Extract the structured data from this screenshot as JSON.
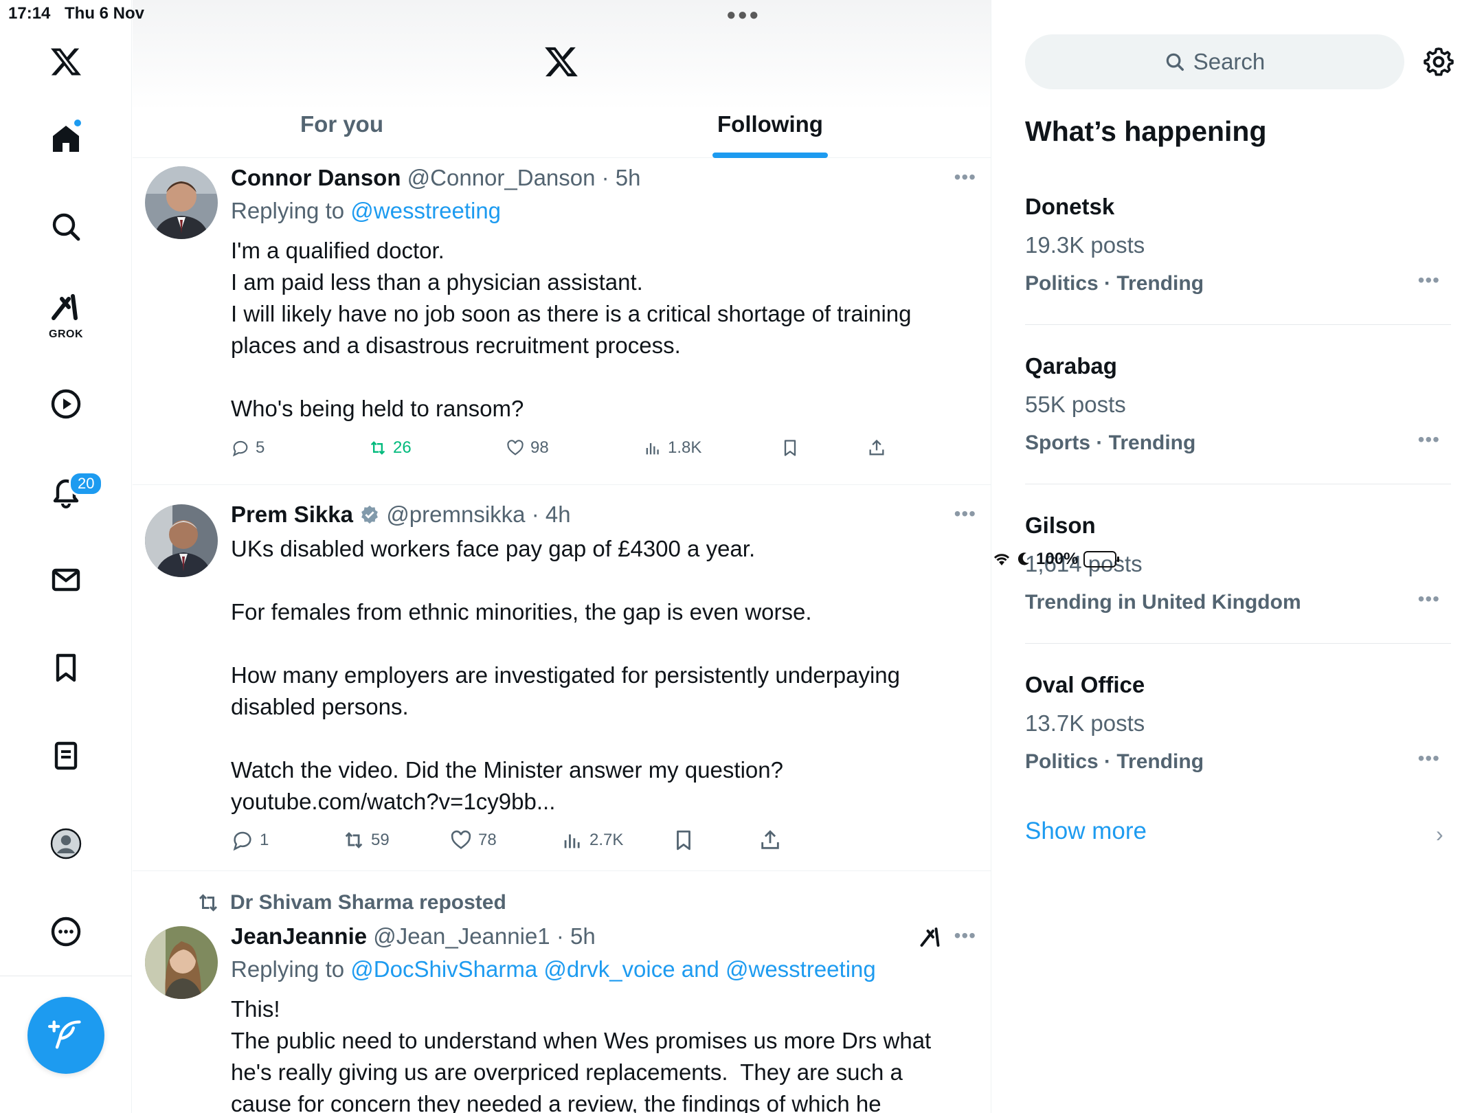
{
  "status_bar": {
    "time": "17:14",
    "date": "Thu 6 Nov",
    "battery": "100%"
  },
  "nav": {
    "notifications_badge": "20",
    "grok_label": "GROK"
  },
  "header": {
    "tabs": [
      {
        "label": "For you"
      },
      {
        "label": "Following"
      }
    ]
  },
  "posts": [
    {
      "name": "Connor Danson",
      "meta": "@Connor_Danson · 5h",
      "replying_prefix": "Replying to ",
      "replying_to": "@wesstreeting",
      "text": "I'm a qualified doctor.\nI am paid less than a physician assistant.\nI will likely have no job soon as there is a critical shortage of training places and a disastrous recruitment process.\n\nWho's being held to ransom?",
      "replies": "5",
      "reposts": "26",
      "likes": "98",
      "views": "1.8K"
    },
    {
      "name": "Prem Sikka",
      "meta": "@premnsikka · 4h",
      "text": "UKs disabled workers face pay gap of £4300 a year.\n\nFor females from ethnic minorities, the gap is even worse.\n\nHow many employers are investigated for persistently underpaying disabled persons.\n\nWatch the video. Did the Minister answer my question?",
      "link": "youtube.com/watch?v=1cy9bb...",
      "replies": "1",
      "reposts": "59",
      "likes": "78",
      "views": "2.7K"
    },
    {
      "reposted_by": "Dr Shivam Sharma reposted",
      "name": "JeanJeannie",
      "meta": "@Jean_Jeannie1 · 5h",
      "replying_prefix": "Replying to ",
      "replying_to": "@DocShivSharma @drvk_voice and @wesstreeting",
      "text": "This!\nThe public need to understand when Wes promises us more Drs what he's really giving us are overpriced replacements.  They are such a cause for concern they needed a review, the findings of which he"
    }
  ],
  "sidebar": {
    "search_placeholder": "Search",
    "title": "What’s happening",
    "trends": [
      {
        "name": "Donetsk",
        "count": "19.3K posts",
        "category": "Politics · Trending"
      },
      {
        "name": "Qarabag",
        "count": "55K posts",
        "category": "Sports · Trending"
      },
      {
        "name": "Gilson",
        "count": "1,614 posts",
        "category": "Trending in United Kingdom"
      },
      {
        "name": "Oval Office",
        "count": "13.7K posts",
        "category": "Politics · Trending"
      }
    ],
    "show_more": "Show more"
  },
  "colors": {
    "accent": "#1d9bf0",
    "repost_green": "#00ba7c",
    "secondary_text": "#536471"
  }
}
